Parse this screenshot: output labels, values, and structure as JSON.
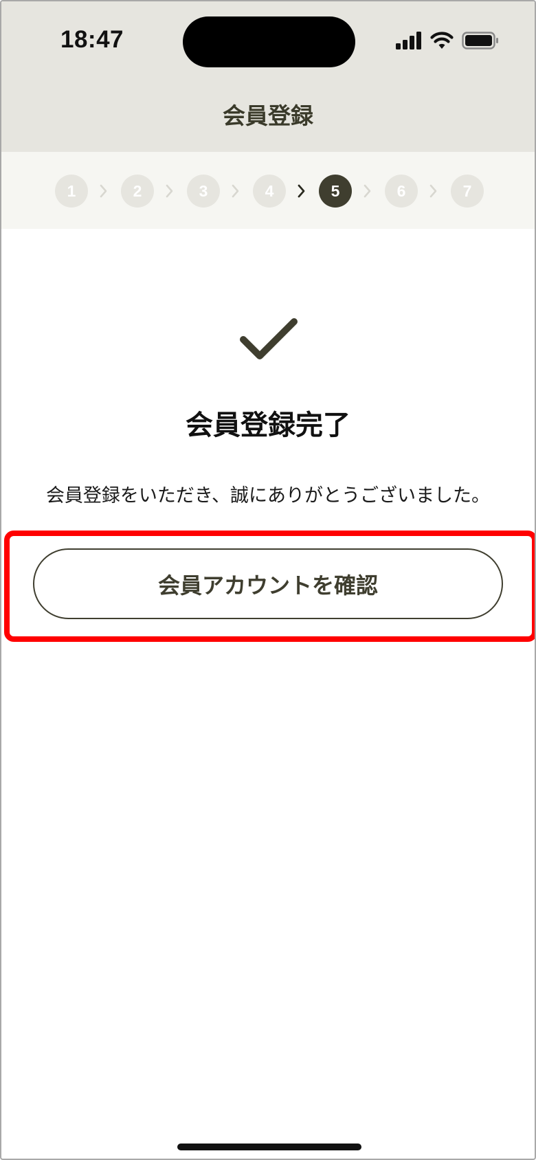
{
  "status_bar": {
    "time": "18:47",
    "icons": [
      "cellular-signal-icon",
      "wifi-icon",
      "battery-icon"
    ]
  },
  "header": {
    "title": "会員登録"
  },
  "stepper": {
    "steps": [
      "1",
      "2",
      "3",
      "4",
      "5",
      "6",
      "7"
    ],
    "current_step": 5
  },
  "content": {
    "icon": "check-icon",
    "title": "会員登録完了",
    "message": "会員登録をいただき、誠にありがとうございました。"
  },
  "actions": {
    "confirm_account_label": "会員アカウントを確認"
  },
  "colors": {
    "header_bg": "#e6e5df",
    "stepper_bg": "#f6f6f2",
    "accent": "#3f3e2f",
    "highlight": "#ff0000"
  }
}
